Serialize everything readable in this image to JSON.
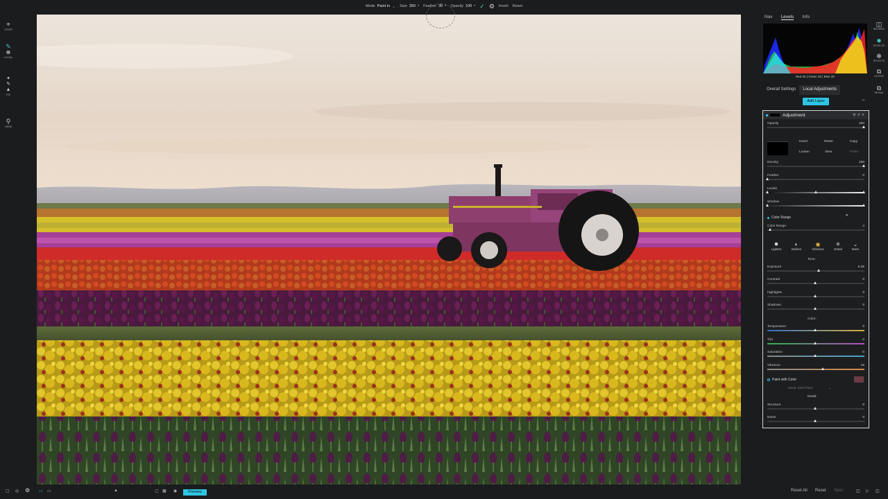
{
  "toolbar": {
    "mode_label": "Mode",
    "mode_value": "Paint in",
    "size_label": "Size",
    "size_value": "350",
    "feather_label": "Feather",
    "feather_value": "30",
    "opacity_label": "Opacity",
    "opacity_value": "100",
    "invert_label": "Invert",
    "reset_label": "Reset"
  },
  "left_tools": [
    {
      "label": "CROP",
      "icon": "crop-icon"
    },
    {
      "label": "LOCAL",
      "icon": "brush-icon"
    },
    {
      "label": "FIX",
      "icon": "stamp-icon"
    },
    {
      "label": "VIEW",
      "icon": "zoom-icon"
    }
  ],
  "right_rail": [
    {
      "label": "BROWSE",
      "icon": "browse-icon"
    },
    {
      "label": "DEVELOP",
      "icon": "develop-icon"
    },
    {
      "label": "EFFECTS",
      "icon": "effects-icon"
    },
    {
      "label": "LAYERS",
      "icon": "layers-icon"
    },
    {
      "label": "RESIZE",
      "icon": "resize-icon"
    }
  ],
  "panel": {
    "tabs": [
      "Nav",
      "Levels",
      "Info"
    ],
    "active_tab": "Levels",
    "histogram_readout": "Red 20  |  Green 20  |  Blue 20",
    "adjust_tabs": [
      "Overall Settings",
      "Local Adjustments"
    ],
    "active_adjust_tab": "Local Adjustments",
    "add_layer": "Add Layer",
    "layer": {
      "name": "Adjustment",
      "opacity_label": "Opacity",
      "opacity_value": "100",
      "buttons": {
        "invert": "Invert",
        "reset": "Reset",
        "copy": "Copy",
        "lumen": "Lumen",
        "view": "View",
        "paste": "Paste"
      },
      "density_label": "Density",
      "density_value": "100",
      "feather_label": "Feather",
      "feather_value": "0",
      "levels_label": "Levels",
      "window_label": "Window",
      "color_range_title": "Color Range",
      "color_range_label": "Color Range",
      "color_range_value": "4",
      "quick": [
        "Lighten",
        "Darken",
        "Vibrance",
        "Detail",
        "More"
      ],
      "tone_title": "Tone:",
      "exposure_label": "Exposure",
      "exposure_value": "0.35",
      "contrast_label": "Contrast",
      "contrast_value": "0",
      "highlights_label": "Highlights",
      "highlights_value": "0",
      "shadows_label": "Shadows",
      "shadows_value": "0",
      "color_title": "Color:",
      "temperature_label": "Temperature",
      "temperature_value": "0",
      "tint_label": "Tint",
      "tint_value": "0",
      "saturation_label": "Saturation",
      "saturation_value": "0",
      "vibrance_label": "Vibrance",
      "vibrance_value": "15",
      "paint_color_title": "Paint with Color",
      "paint_mode": "Mode:  Solid Paint",
      "detail_title": "Detail:",
      "structure_label": "Structure",
      "structure_value": "0",
      "noise_label": "Noise",
      "noise_value": "0"
    }
  },
  "bottom": {
    "preview": "Preview",
    "reset_all": "Reset All",
    "reset": "Reset",
    "sync": "Sync"
  },
  "colors": {
    "accent": "#2ec5e3",
    "panel_bg": "#1b1c1e"
  }
}
